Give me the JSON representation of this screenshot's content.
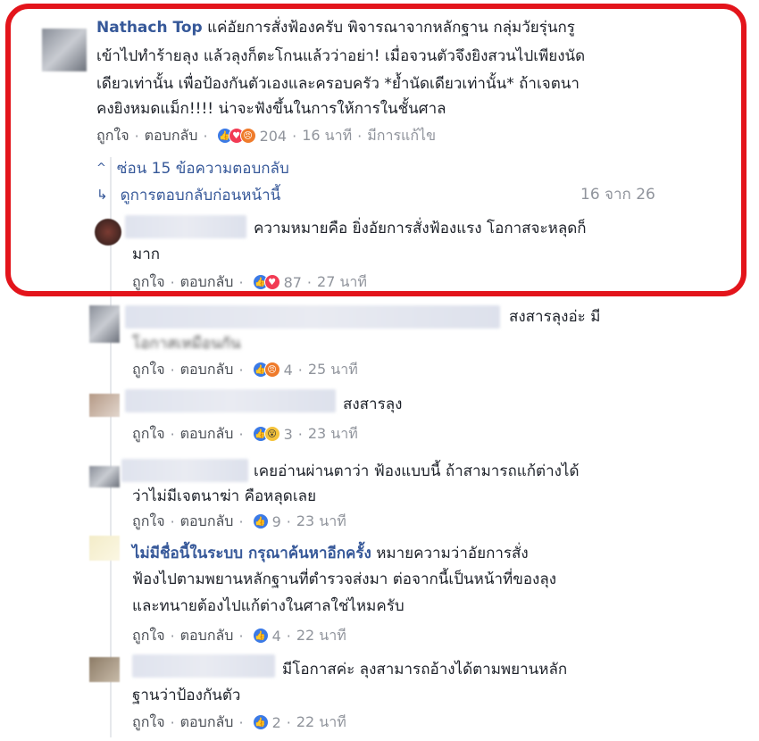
{
  "comments": [
    {
      "id": "c1",
      "name": "Nathach Top",
      "lines": [
        "แค่อัยการสั่งฟ้องครับ พิจารณาจากหลักฐาน กลุ่มวัยรุ่นกรู",
        "เข้าไปทำร้ายลุง แล้วลุงก็ตะโกนแล้วว่าอย่า! เมื่อจวนตัวจึงยิงสวนไปเพียงนัด",
        "เดียวเท่านั้น เพื่อป้องกันตัวเองและครอบครัว *ย้ำนัดเดียวเท่านั้น* ถ้าเจตนา",
        "คงยิงหมดแม็ก!!!! น่าจะฟังขึ้นในการให้การในชั้นศาล"
      ],
      "like": "ถูกใจ",
      "reply": "ตอบกลับ",
      "count": "204",
      "time": "16 นาที",
      "edited": "มีการแก้ไข"
    },
    {
      "id": "r1",
      "lines": [
        "ความหมายคือ ยิ่งอัยการสั่งฟ้องแรง โอกาสจะหลุดก็",
        "มาก"
      ],
      "like": "ถูกใจ",
      "reply": "ตอบกลับ",
      "count": "87",
      "time": "27 นาที"
    },
    {
      "id": "r2",
      "lines": [
        "สงสารลุงอ่ะ มี",
        "โอกาสเหมือนกัน"
      ],
      "like": "ถูกใจ",
      "reply": "ตอบกลับ",
      "count": "4",
      "time": "25 นาที"
    },
    {
      "id": "r3",
      "lines": [
        "สงสารลุง"
      ],
      "like": "ถูกใจ",
      "reply": "ตอบกลับ",
      "count": "3",
      "time": "23 นาที"
    },
    {
      "id": "r4",
      "lines": [
        "เคยอ่านผ่านตาว่า ฟ้องแบบนี้ ถ้าสามารถแก้ต่างได้",
        "ว่าไม่มีเจตนาฆ่า คือหลุดเลย"
      ],
      "like": "ถูกใจ",
      "reply": "ตอบกลับ",
      "count": "9",
      "time": "23 นาที"
    },
    {
      "id": "r5",
      "name": "ไม่มีชื่อนี้ในระบบ กรุณาค้นหาอีกครั้ง",
      "lines": [
        "หมายความว่าอัยการสั่ง",
        "ฟ้องไปตามพยานหลักฐานที่ตำรวจส่งมา ต่อจากนี้เป็นหน้าที่ของลุง",
        "และทนายต้องไปแก้ต่างในศาลใช่ไหมครับ"
      ],
      "like": "ถูกใจ",
      "reply": "ตอบกลับ",
      "count": "4",
      "time": "22 นาที"
    },
    {
      "id": "r6",
      "lines": [
        "มีโอกาสค่ะ ลุงสามารถอ้างได้ตามพยานหลัก",
        "ฐานว่าป้องกันตัว"
      ],
      "like": "ถูกใจ",
      "reply": "ตอบกลับ",
      "count": "2",
      "time": "22 นาที"
    }
  ],
  "thread": {
    "hide_replies": "ซ่อน 15 ข้อความตอบกลับ",
    "view_previous": "ดูการตอบกลับก่อนหน้านี้",
    "pagination": "16 จาก 26"
  },
  "icons": {
    "chevron": "chevron-up-icon",
    "reply_arrow": "reply-arrow-icon",
    "like": "like-reaction-icon",
    "love": "love-reaction-icon",
    "angry": "angry-reaction-icon",
    "wow": "wow-reaction-icon"
  },
  "colors": {
    "highlight_border": "#e3141b",
    "link": "#365899",
    "meta": "#90949c",
    "like_blue": "#3b7ae6",
    "love_red": "#f23b54"
  }
}
